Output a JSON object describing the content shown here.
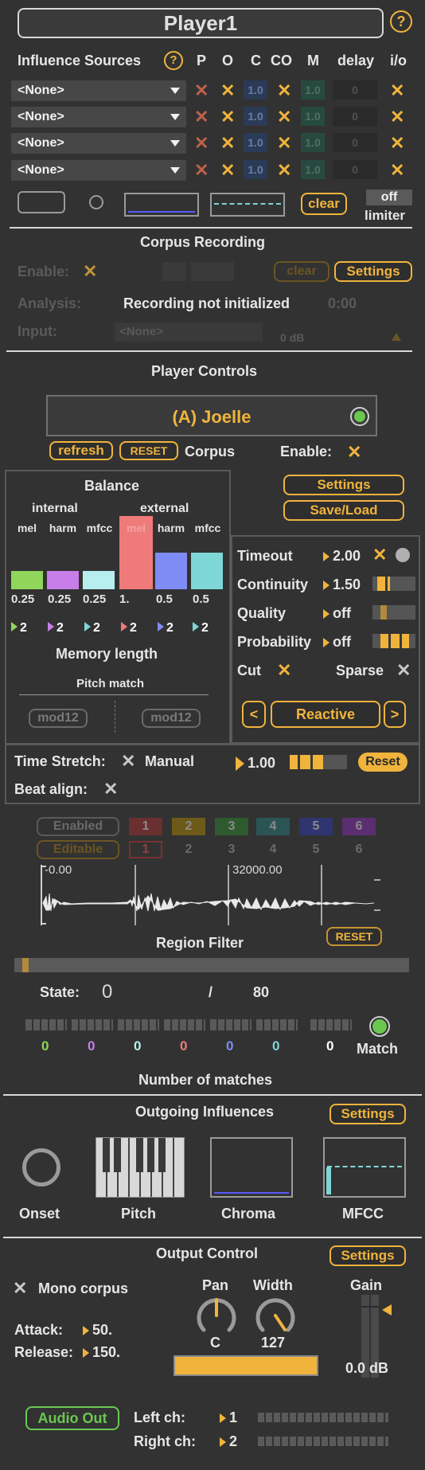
{
  "header": {
    "title": "Player1",
    "help": "?"
  },
  "influence": {
    "title": "Influence Sources",
    "help": "?",
    "columns": [
      "P",
      "O",
      "C",
      "CO",
      "M",
      "delay",
      "i/o"
    ],
    "rows": [
      {
        "source": "<None>",
        "c": "1.0",
        "m": "1.0",
        "delay": "0"
      },
      {
        "source": "<None>",
        "c": "1.0",
        "m": "1.0",
        "delay": "0"
      },
      {
        "source": "<None>",
        "c": "1.0",
        "m": "1.0",
        "delay": "0"
      },
      {
        "source": "<None>",
        "c": "1.0",
        "m": "1.0",
        "delay": "0"
      }
    ],
    "clear": "clear",
    "limiter_value": "off",
    "limiter_label": "limiter"
  },
  "corpus_recording": {
    "title": "Corpus Recording",
    "enable": "Enable:",
    "clear": "clear",
    "settings": "Settings",
    "analysis": "Analysis:",
    "status": "Recording not initialized",
    "time": "0:00",
    "input": "Input:",
    "input_value": "<None>",
    "level": "0 dB"
  },
  "player_controls": {
    "title": "Player Controls",
    "corpus_name": "(A) Joelle",
    "refresh": "refresh",
    "reset": "RESET",
    "corpus": "Corpus",
    "enable": "Enable:",
    "settings": "Settings",
    "saveload": "Save/Load"
  },
  "balance": {
    "title": "Balance",
    "internal": "internal",
    "external": "external",
    "labels": [
      "mel",
      "harm",
      "mfcc",
      "mel",
      "harm",
      "mfcc"
    ],
    "values": [
      "0.25",
      "0.25",
      "0.25",
      "1.",
      "0.5",
      "0.5"
    ],
    "levels": [
      0.25,
      0.25,
      0.25,
      1.0,
      0.5,
      0.5
    ],
    "colors": [
      "#8fd65a",
      "#c77ee8",
      "#b8eeee",
      "#ef7a7a",
      "#7f8cf5",
      "#7ed6d6"
    ],
    "memory": [
      "2",
      "2",
      "2",
      "2",
      "2",
      "2"
    ],
    "memory_colors": [
      "#8fd65a",
      "#c77ee8",
      "#7ed6d6",
      "#ef7a7a",
      "#7f8cf5",
      "#7ed6d6"
    ],
    "memory_label": "Memory length",
    "pitch_match": "Pitch match",
    "mod_left": "mod12",
    "mod_right": "mod12"
  },
  "params": {
    "timeout": "Timeout",
    "timeout_value": "2.00",
    "continuity": "Continuity",
    "continuity_value": "1.50",
    "quality": "Quality",
    "quality_value": "off",
    "probability": "Probability",
    "probability_value": "off",
    "cut": "Cut",
    "sparse": "Sparse",
    "prev": "<",
    "mode": "Reactive",
    "next": ">"
  },
  "timestretch": {
    "label": "Time Stretch:",
    "manual": "Manual",
    "value": "1.00",
    "reset": "Reset",
    "beat": "Beat align:"
  },
  "region": {
    "enabled": "Enabled",
    "editable": "Editable",
    "slots": [
      "1",
      "2",
      "3",
      "4",
      "5",
      "6"
    ],
    "slot_colors": [
      "#6a3030",
      "#6e5a18",
      "#2f5a2f",
      "#2b5555",
      "#2e3570",
      "#5a2e70"
    ],
    "start": "-0.00",
    "end": "32000.00",
    "title": "Region Filter",
    "reset": "RESET",
    "state_label": "State:",
    "state_value": "0",
    "state_sep": "/",
    "state_total": "80",
    "counts": [
      "0",
      "0",
      "0",
      "0",
      "0",
      "0",
      "0"
    ],
    "count_colors": [
      "#8fd65a",
      "#c77ee8",
      "#b8eeee",
      "#ef7a7a",
      "#7f8cf5",
      "#7ed6d6",
      "#ffffff"
    ],
    "match": "Match",
    "matches_title": "Number of matches"
  },
  "outgoing": {
    "title": "Outgoing Influences",
    "settings": "Settings",
    "onset": "Onset",
    "pitch": "Pitch",
    "chroma": "Chroma",
    "mfcc": "MFCC"
  },
  "output": {
    "title": "Output Control",
    "settings": "Settings",
    "mono": "Mono corpus",
    "pan": "Pan",
    "pan_value": "C",
    "width": "Width",
    "width_value": "127",
    "gain": "Gain",
    "gain_value": "0.0 dB",
    "attack": "Attack:",
    "attack_value": "50.",
    "release": "Release:",
    "release_value": "150.",
    "audio_out": "Audio Out",
    "left": "Left ch:",
    "left_value": "1",
    "right": "Right ch:",
    "right_value": "2"
  }
}
